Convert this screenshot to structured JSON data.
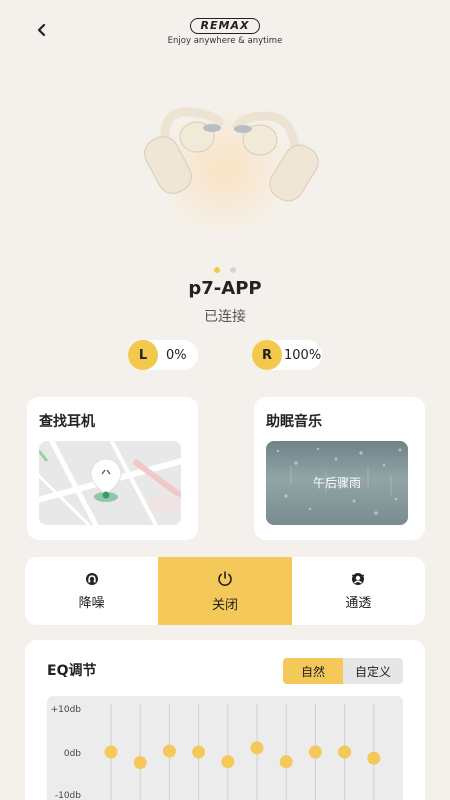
{
  "header": {
    "brand": "REMAX",
    "tagline": "Enjoy anywhere & anytime"
  },
  "carousel": {
    "pages": 2,
    "active_index": 0
  },
  "device": {
    "name": "p7-APP",
    "status": "已连接"
  },
  "battery": {
    "left": {
      "label": "L",
      "value": "0%"
    },
    "right": {
      "label": "R",
      "value": "100%"
    }
  },
  "cards": {
    "find": {
      "title": "查找耳机"
    },
    "sleep": {
      "title": "助眠音乐",
      "track": "午后骤雨"
    }
  },
  "modes": [
    {
      "label": "降噪",
      "icon": "noise-cancel-icon",
      "active": false
    },
    {
      "label": "关闭",
      "icon": "power-icon",
      "active": true
    },
    {
      "label": "通透",
      "icon": "transparency-icon",
      "active": false
    }
  ],
  "eq": {
    "title": "EQ调节",
    "presets": [
      {
        "label": "自然",
        "active": true
      },
      {
        "label": "自定义",
        "active": false
      }
    ],
    "ticks": [
      "+10db",
      "0db",
      "-10db"
    ],
    "bands": [
      0,
      -2.5,
      0.2,
      0,
      -2.3,
      1,
      -2.3,
      0,
      0,
      -1.5
    ]
  },
  "colors": {
    "accent": "#f5c85a",
    "background": "#f4f1ec"
  }
}
